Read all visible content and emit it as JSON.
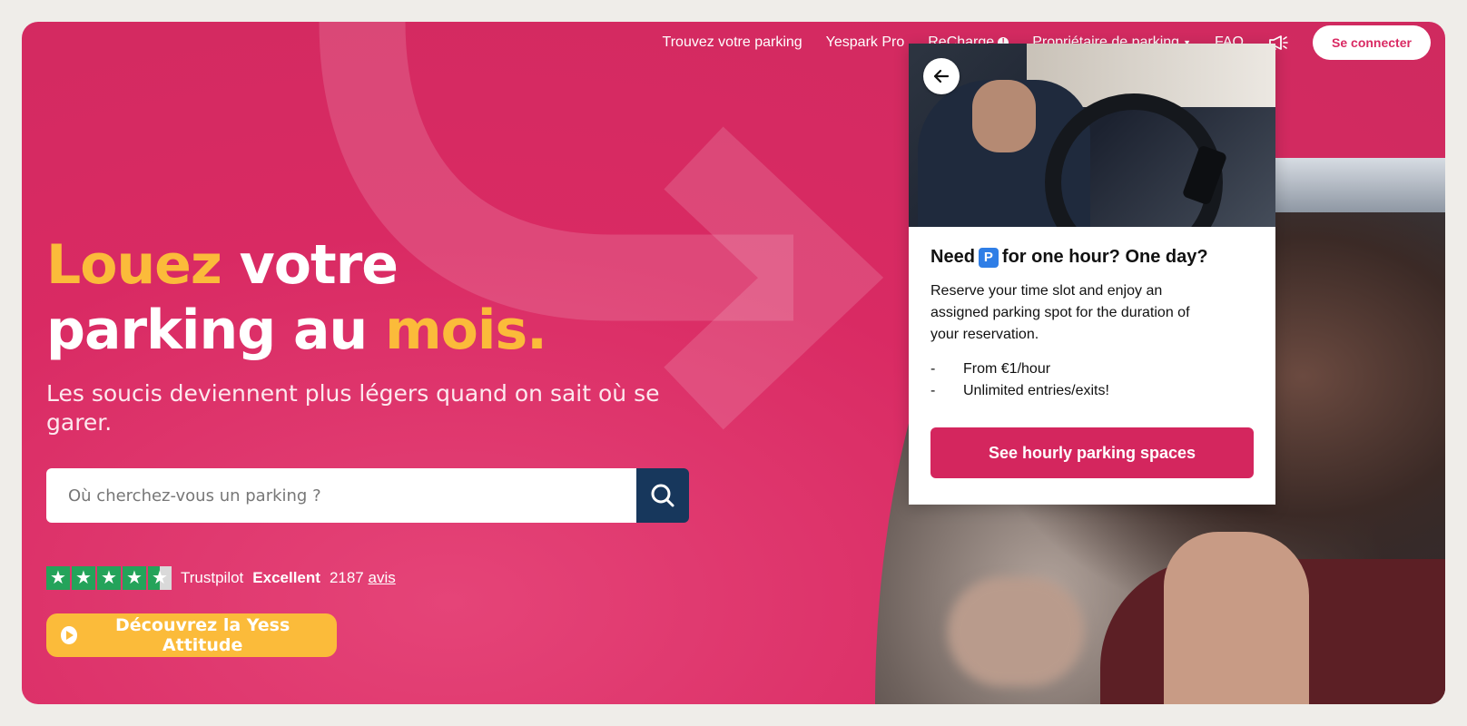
{
  "nav": {
    "items": [
      {
        "label": "Trouvez votre parking"
      },
      {
        "label": "Yespark Pro"
      },
      {
        "label": "ReCharge"
      },
      {
        "label": "Propriétaire de parking"
      },
      {
        "label": "FAQ"
      }
    ],
    "login_label": "Se connecter"
  },
  "hero": {
    "title_part1": "Louez",
    "title_part2": " votre",
    "title_part3": "parking au ",
    "title_part4": "mois.",
    "subtitle": "Les soucis deviennent plus légers quand on sait où se garer."
  },
  "search": {
    "placeholder": "Où cherchez-vous un parking ?"
  },
  "trustpilot": {
    "brand": "Trustpilot",
    "rating_word": "Excellent",
    "count": "2187",
    "reviews_label": "avis",
    "stars": 4.5
  },
  "yess_button": {
    "label": "Découvrez la Yess Attitude"
  },
  "card": {
    "title_before": "Need",
    "title_badge": "P",
    "title_after": "for one hour? One day?",
    "description": "Reserve your time slot and enjoy an assigned parking spot for the duration of your reservation.",
    "bullets": [
      "From €1/hour",
      "Unlimited entries/exits!"
    ],
    "cta_label": "See hourly parking spaces"
  },
  "colors": {
    "brand_pink": "#d92a63",
    "accent_yellow": "#fbbb3a",
    "search_navy": "#17375c",
    "trustpilot_green": "#24a35a"
  }
}
